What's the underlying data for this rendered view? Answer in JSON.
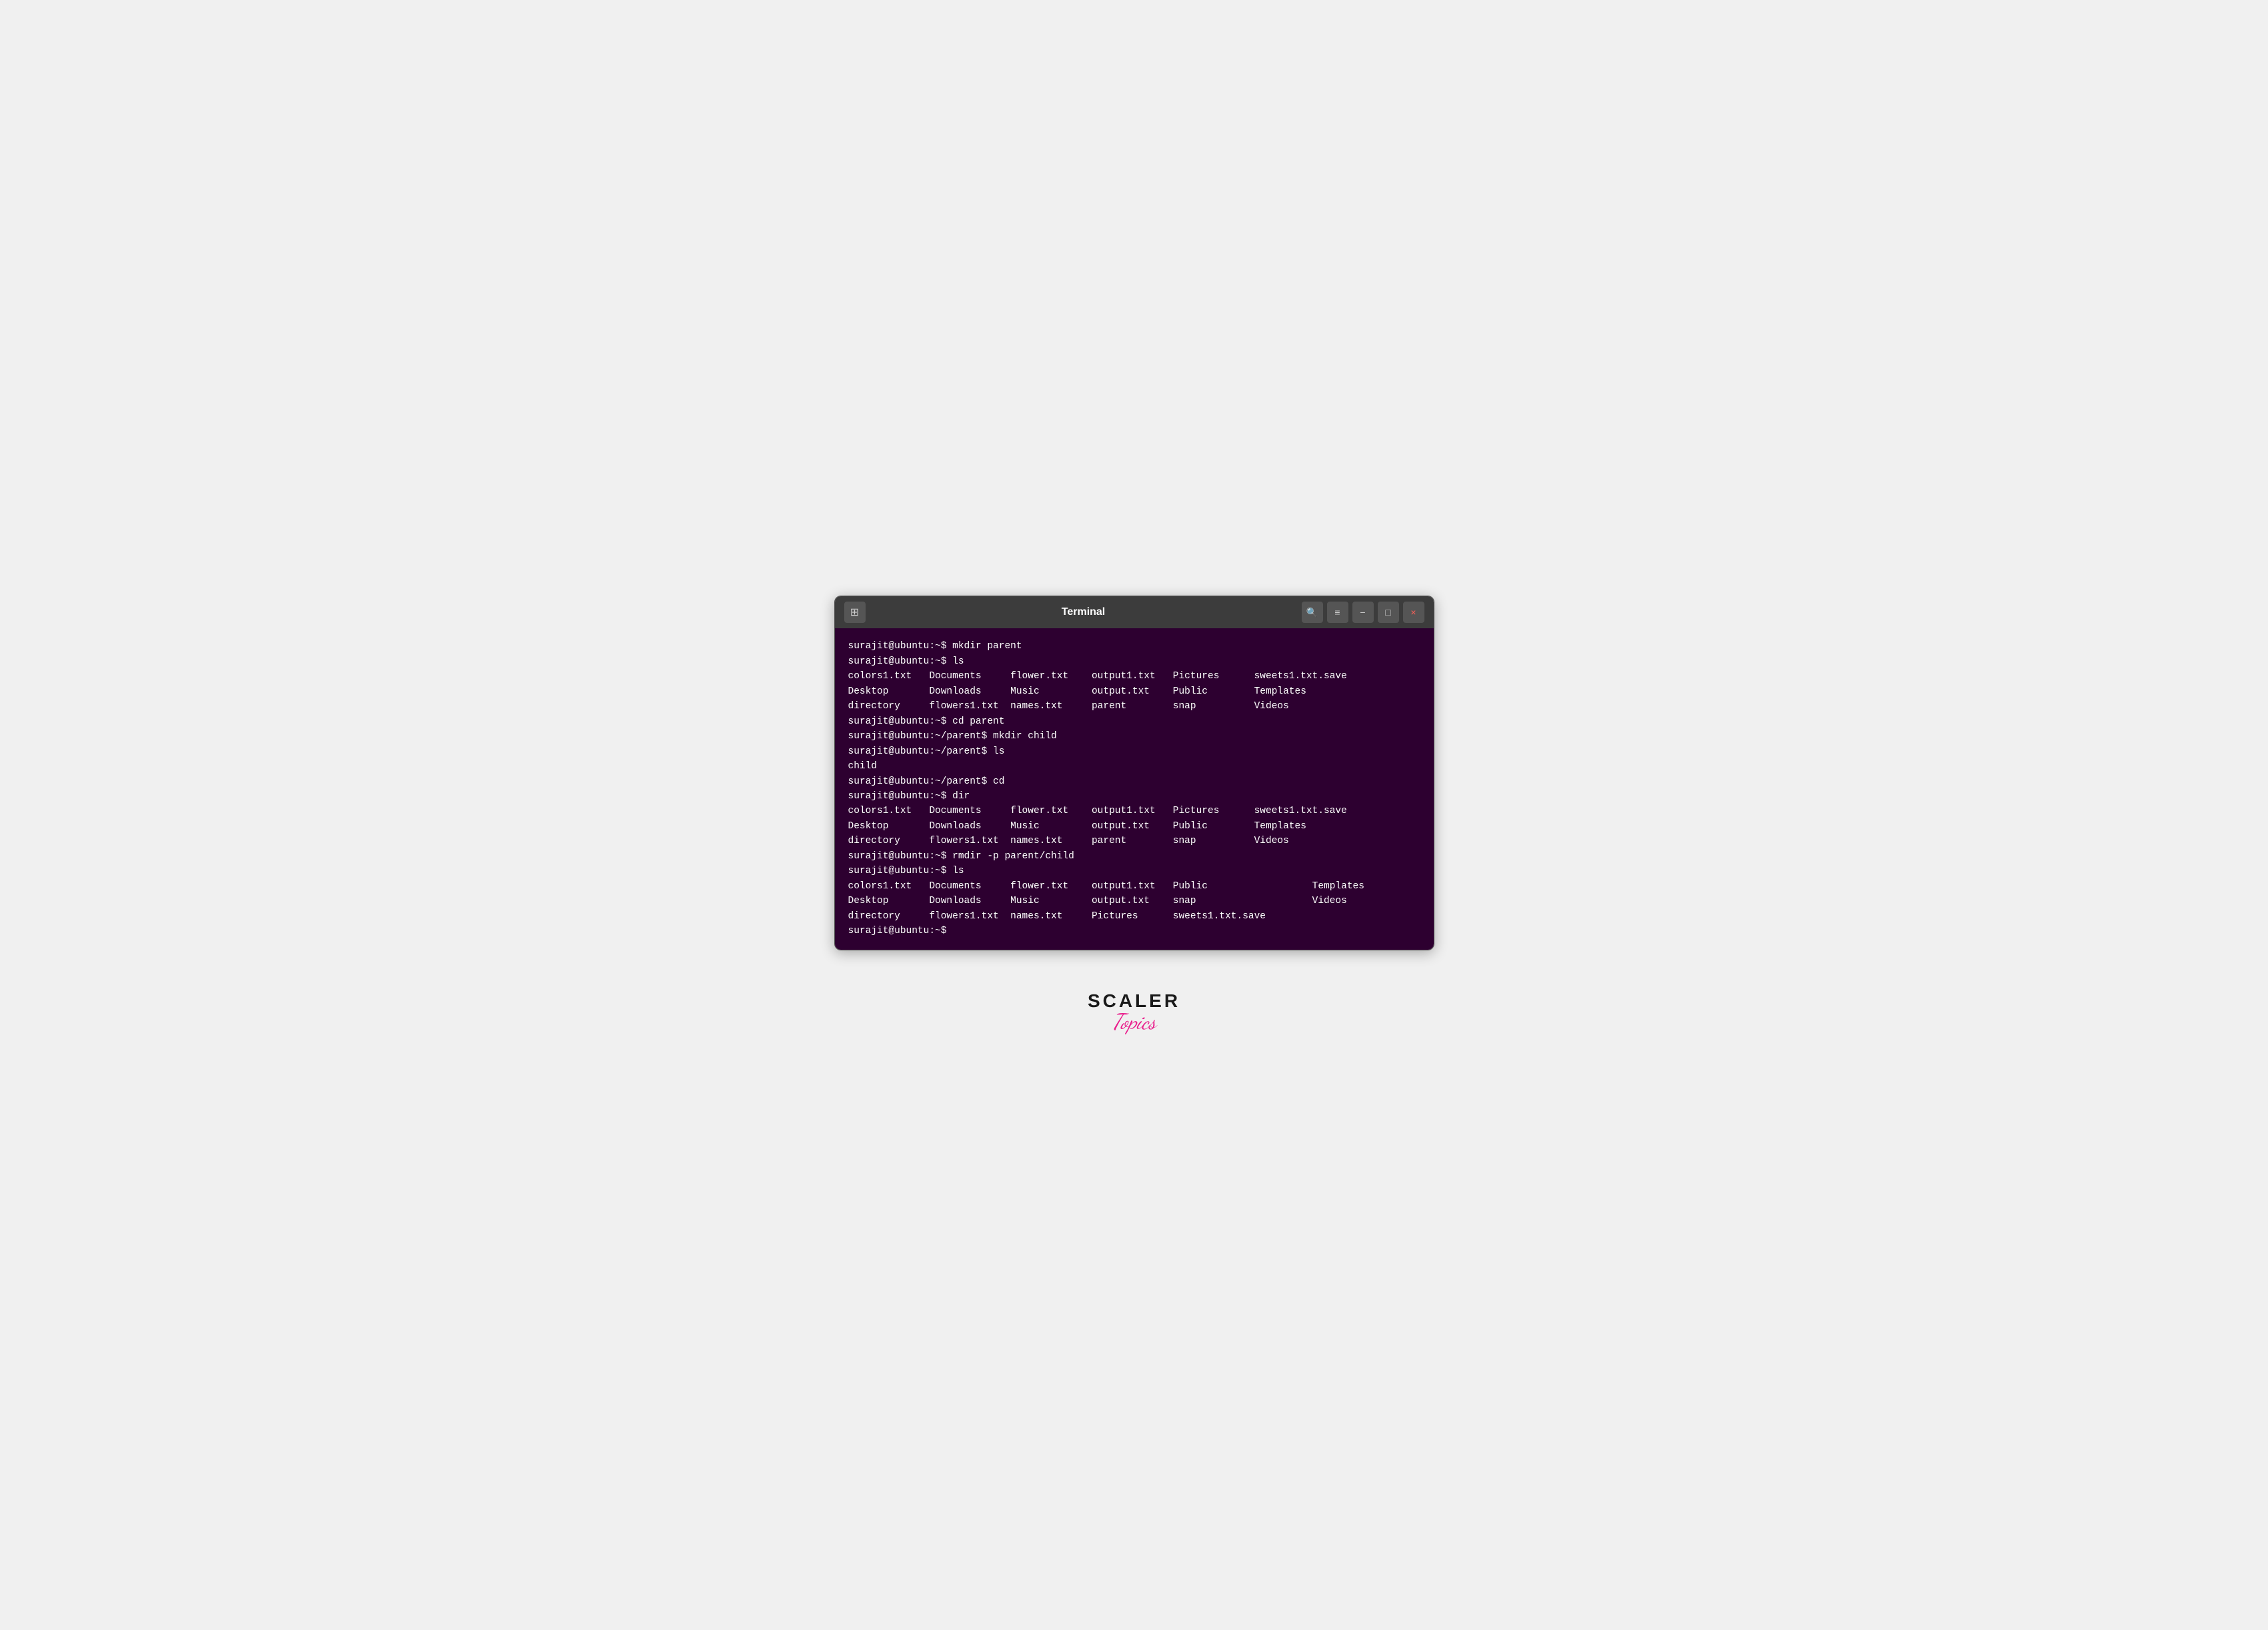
{
  "terminal": {
    "title": "Terminal",
    "new_tab_label": "⊞",
    "controls": {
      "search": "🔍",
      "menu": "≡",
      "minimize": "–",
      "maximize": "□",
      "close": "×"
    },
    "content": "surajit@ubuntu:~$ mkdir parent\nsurajit@ubuntu:~$ ls\ncolors1.txt   Documents     flower.txt    output1.txt   Pictures      sweets1.txt.save\nDesktop       Downloads     Music         output.txt    Public        Templates\ndirectory     flowers1.txt  names.txt     parent        snap          Videos\nsurajit@ubuntu:~$ cd parent\nsurajit@ubuntu:~/parent$ mkdir child\nsurajit@ubuntu:~/parent$ ls\nchild\nsurajit@ubuntu:~/parent$ cd\nsurajit@ubuntu:~$ dir\ncolors1.txt   Documents     flower.txt    output1.txt   Pictures      sweets1.txt.save\nDesktop       Downloads     Music         output.txt    Public        Templates\ndirectory     flowers1.txt  names.txt     parent        snap          Videos\nsurajit@ubuntu:~$ rmdir -p parent/child\nsurajit@ubuntu:~$ ls\ncolors1.txt   Documents     flower.txt    output1.txt   Public                  Templates\nDesktop       Downloads     Music         output.txt    snap                    Videos\ndirectory     flowers1.txt  names.txt     Pictures      sweets1.txt.save\nsurajit@ubuntu:~$ "
  },
  "logo": {
    "scaler": "SCALER",
    "topics": "Topics"
  }
}
